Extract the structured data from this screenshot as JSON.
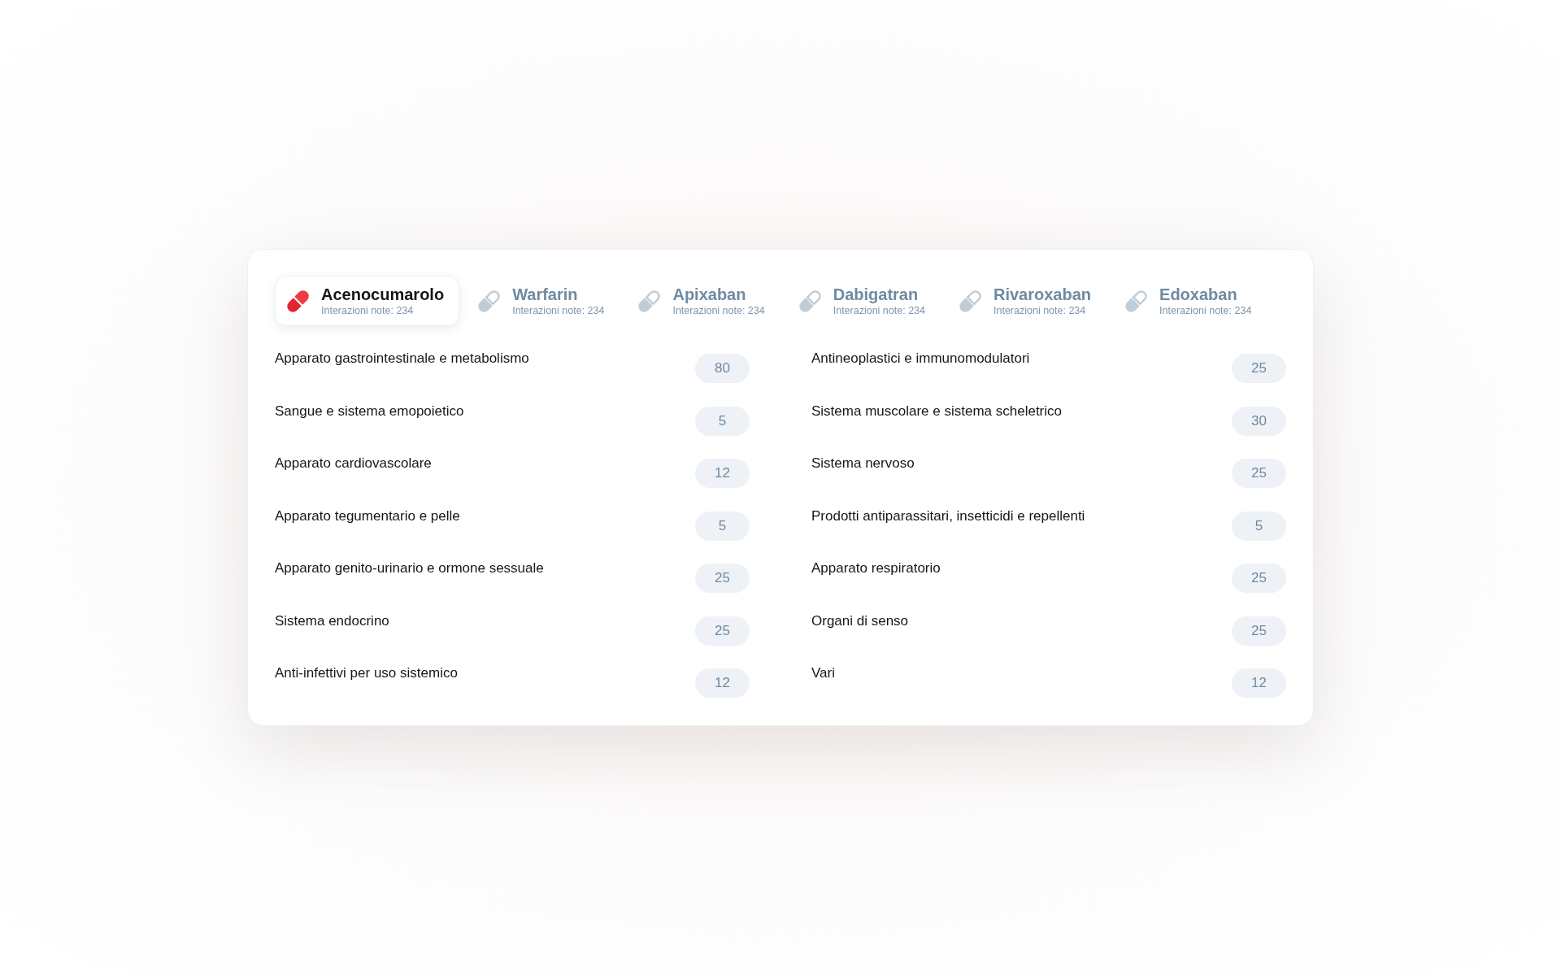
{
  "tabs": [
    {
      "name": "Acenocumarolo",
      "subtitle": "Interazioni note: 234",
      "selected": true
    },
    {
      "name": "Warfarin",
      "subtitle": "Interazioni note: 234",
      "selected": false
    },
    {
      "name": "Apixaban",
      "subtitle": "Interazioni note: 234",
      "selected": false
    },
    {
      "name": "Dabigatran",
      "subtitle": "Interazioni note: 234",
      "selected": false
    },
    {
      "name": "Rivaroxaban",
      "subtitle": "Interazioni note: 234",
      "selected": false
    },
    {
      "name": "Edoxaban",
      "subtitle": "Interazioni note: 234",
      "selected": false
    }
  ],
  "category_columns": [
    {
      "items": [
        {
          "label": "Apparato gastrointestinale e metabolismo",
          "count": "80"
        },
        {
          "label": "Sangue e sistema emopoietico",
          "count": "5"
        },
        {
          "label": "Apparato cardiovascolare",
          "count": "12"
        },
        {
          "label": "Apparato tegumentario e pelle",
          "count": "5"
        },
        {
          "label": "Apparato genito-urinario e ormone sessuale",
          "count": "25"
        },
        {
          "label": "Sistema endocrino",
          "count": "25"
        },
        {
          "label": "Anti-infettivi per uso sistemico",
          "count": "12"
        }
      ]
    },
    {
      "items": [
        {
          "label": "Antineoplastici e immunomodulatori",
          "count": "25"
        },
        {
          "label": "Sistema muscolare e sistema scheletrico",
          "count": "30"
        },
        {
          "label": "Sistema nervoso",
          "count": "25"
        },
        {
          "label": "Prodotti antiparassitari, insetticidi e repellenti",
          "count": "5"
        },
        {
          "label": "Apparato respiratorio",
          "count": "25"
        },
        {
          "label": "Organi di senso",
          "count": "25"
        },
        {
          "label": "Vari",
          "count": "12"
        }
      ]
    }
  ]
}
